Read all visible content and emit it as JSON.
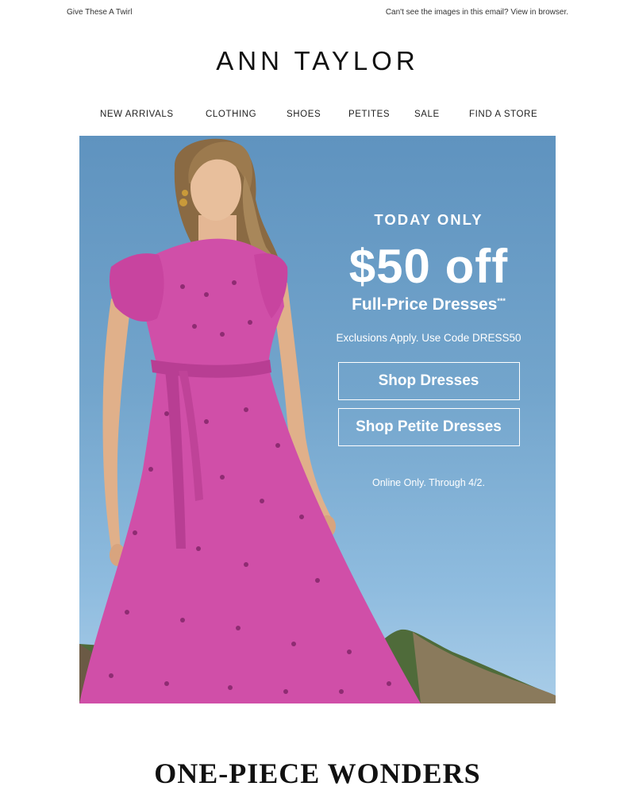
{
  "preheader": {
    "left_text": "Give These A Twirl",
    "right_text": "Can't see the images in this email? View in browser."
  },
  "brand": {
    "logo_text": "ANN TAYLOR"
  },
  "nav": {
    "items": [
      {
        "label": "NEW ARRIVALS"
      },
      {
        "label": "CLOTHING"
      },
      {
        "label": "SHOES"
      },
      {
        "label": "PETITES"
      },
      {
        "label": "SALE"
      },
      {
        "label": "FIND A STORE"
      }
    ]
  },
  "hero": {
    "kicker": "TODAY ONLY",
    "offer": "$50 off",
    "subhead": "Full-Price Dresses",
    "subhead_mark": "***",
    "terms": "Exclusions Apply. Use Code DRESS50",
    "cta_primary": "Shop Dresses",
    "cta_secondary": "Shop Petite Dresses",
    "fine_print": "Online Only. Through 4/2.",
    "colors": {
      "sky": "#6a9ec8",
      "dress": "#d04fa8",
      "text": "#ffffff"
    }
  },
  "section": {
    "title": "ONE-PIECE WONDERS"
  }
}
